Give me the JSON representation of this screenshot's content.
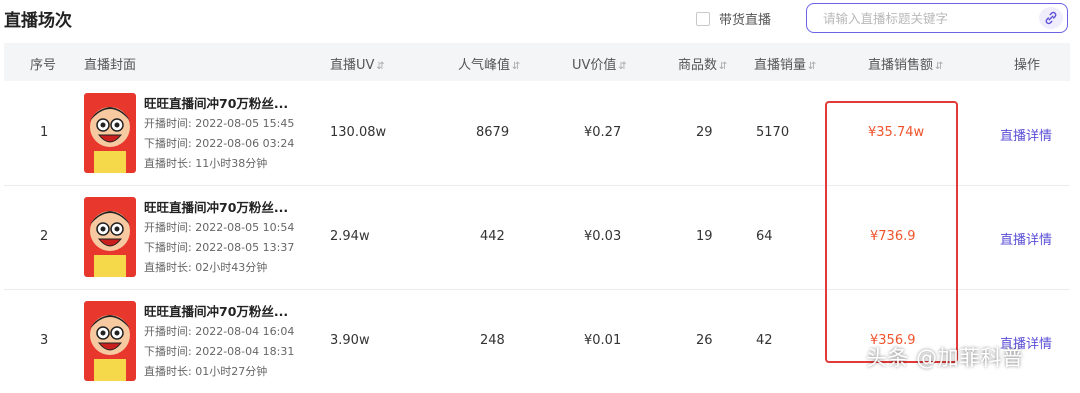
{
  "page": {
    "title": "直播场次"
  },
  "filter": {
    "checkbox_label": "带货直播",
    "checked": false
  },
  "search": {
    "placeholder": "请输入直播标题关键字",
    "icon": "link-search-icon"
  },
  "table": {
    "headers": [
      "序号",
      "直播封面",
      "直播UV",
      "人气峰值",
      "UV价值",
      "商品数",
      "直播销量",
      "直播销售额",
      "操作"
    ],
    "sort_glyph": "⇵",
    "labels": {
      "start": "开播时间: ",
      "end": "下播时间: ",
      "duration": "直播时长: "
    },
    "rows": [
      {
        "index": "1",
        "title": "旺旺直播间冲70万粉丝...",
        "start": "2022-08-05 15:45",
        "end": "2022-08-06 03:24",
        "duration": "11小时38分钟",
        "uv": "130.08w",
        "peak": "8679",
        "uv_value": "¥0.27",
        "products": "29",
        "sales_count": "5170",
        "sales_amount": "¥35.74w",
        "action": "直播详情"
      },
      {
        "index": "2",
        "title": "旺旺直播间冲70万粉丝...",
        "start": "2022-08-05 10:54",
        "end": "2022-08-05 13:37",
        "duration": "02小时43分钟",
        "uv": "2.94w",
        "peak": "442",
        "uv_value": "¥0.03",
        "products": "19",
        "sales_count": "64",
        "sales_amount": "¥736.9",
        "action": "直播详情"
      },
      {
        "index": "3",
        "title": "旺旺直播间冲70万粉丝...",
        "start": "2022-08-04 16:04",
        "end": "2022-08-04 18:31",
        "duration": "01小时27分钟",
        "uv": "3.90w",
        "peak": "248",
        "uv_value": "¥0.01",
        "products": "26",
        "sales_count": "42",
        "sales_amount": "¥356.9",
        "action": "直播详情"
      }
    ]
  },
  "colors": {
    "accent": "#5a4fd6",
    "sales": "#f0542d",
    "highlight_border": "#e23a3a",
    "header_bg": "#f4f5f7"
  },
  "watermark": "头条 @加菲科普"
}
